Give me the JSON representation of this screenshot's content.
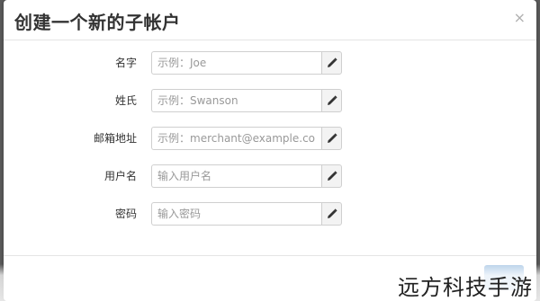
{
  "dialog": {
    "title": "创建一个新的子帐户",
    "close_symbol": "×"
  },
  "form": {
    "fields": [
      {
        "label": "名字",
        "placeholder": "示例：Joe",
        "icon": "pencil-icon"
      },
      {
        "label": "姓氏",
        "placeholder": "示例：Swanson",
        "icon": "pencil-icon"
      },
      {
        "label": "邮箱地址",
        "placeholder": "示例：merchant@example.com",
        "icon": "pencil-icon"
      },
      {
        "label": "用户名",
        "placeholder": "输入用户名",
        "icon": "pencil-icon"
      },
      {
        "label": "密码",
        "placeholder": "输入密码",
        "icon": "pencil-icon"
      }
    ]
  },
  "watermark": {
    "text": "远方科技手游"
  },
  "colors": {
    "backdrop": "#5b5b5b",
    "primary_button": "#b9d2ea"
  }
}
